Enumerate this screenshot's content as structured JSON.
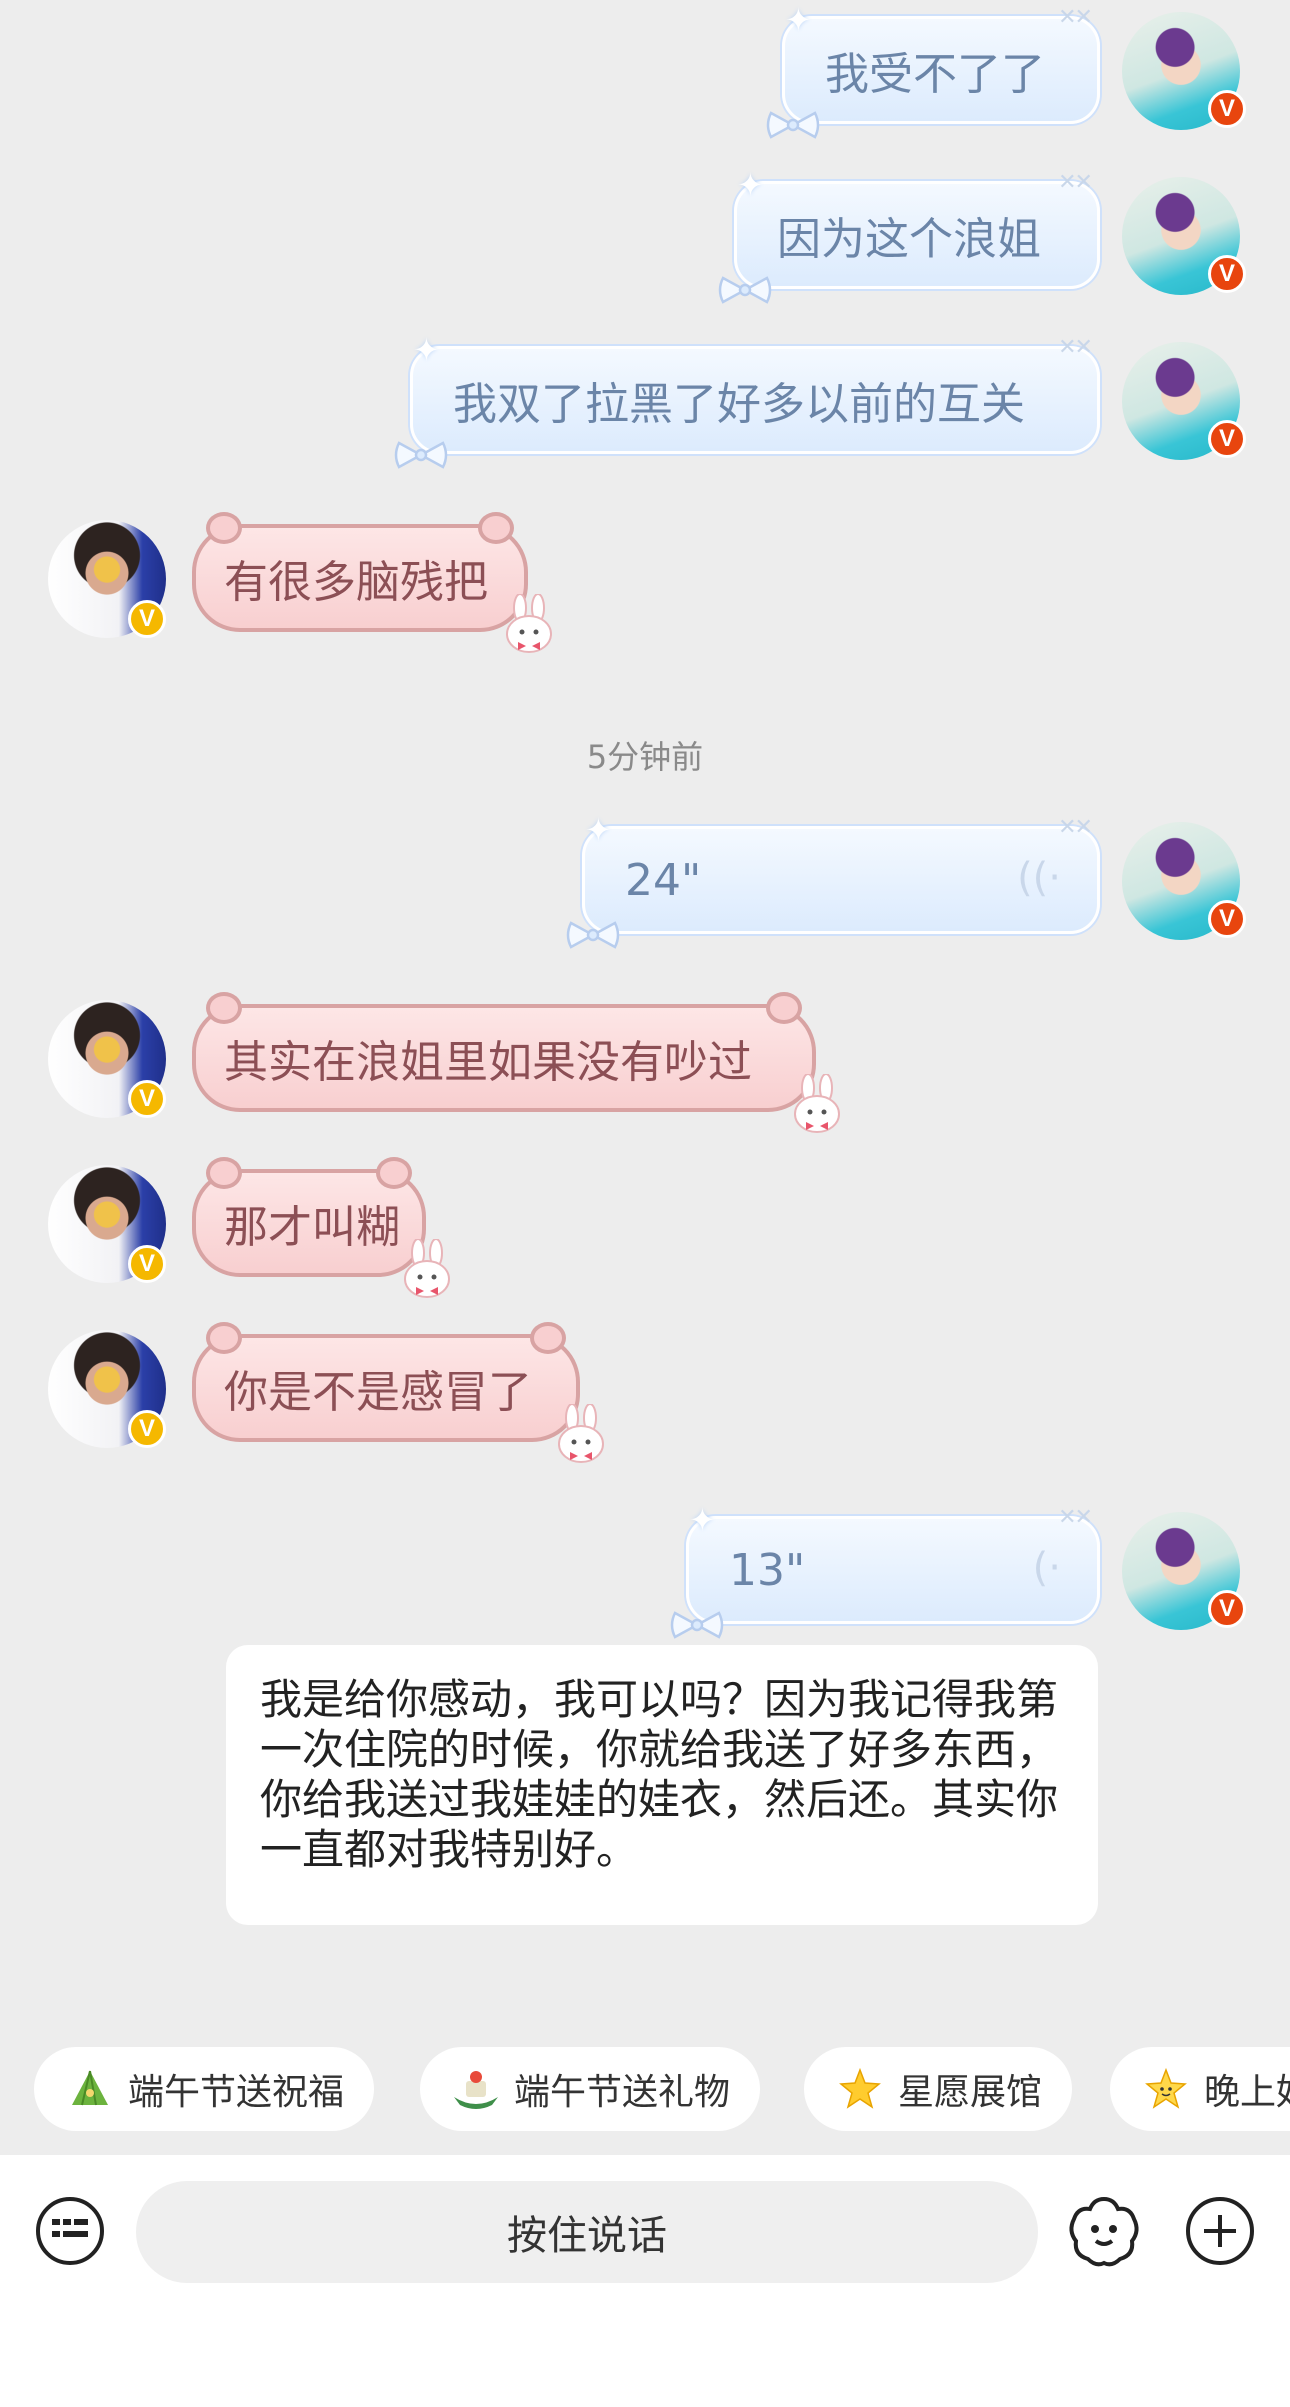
{
  "messages_me": [
    {
      "text": "我受不了了"
    },
    {
      "text": "因为这个浪姐"
    },
    {
      "text": "我双了拉黑了好多以前的互关"
    }
  ],
  "message_other_1": {
    "text": "有很多脑残把"
  },
  "timestamp": "5分钟前",
  "voice_1": {
    "duration": "24\""
  },
  "messages_other": [
    {
      "text": "其实在浪姐里如果没有吵过"
    },
    {
      "text": "那才叫糊"
    },
    {
      "text": "你是不是感冒了"
    }
  ],
  "voice_2": {
    "duration": "13\""
  },
  "transcript": {
    "text": "我是给你感动，我可以吗？因为我记得我第一次住院的时候，你就给我送了好多东西，你给我送过我娃娃的娃衣，然后还。其实你一直都对我特别好。"
  },
  "chips": [
    {
      "label": "端午节送祝福",
      "icon": "zongzi-icon"
    },
    {
      "label": "端午节送礼物",
      "icon": "dragon-boat-icon"
    },
    {
      "label": "星愿展馆",
      "icon": "star-icon"
    },
    {
      "label": "晚上好",
      "icon": "star-face-icon"
    }
  ],
  "bottom_bar": {
    "hold_to_talk": "按住说话"
  },
  "badge": {
    "verified": "V"
  },
  "colors": {
    "background": "#ededed",
    "bubble_me": "#dcebfd",
    "bubble_other": "#f8cfd0",
    "badge_red": "#e8450e",
    "badge_gold": "#f5b800"
  }
}
